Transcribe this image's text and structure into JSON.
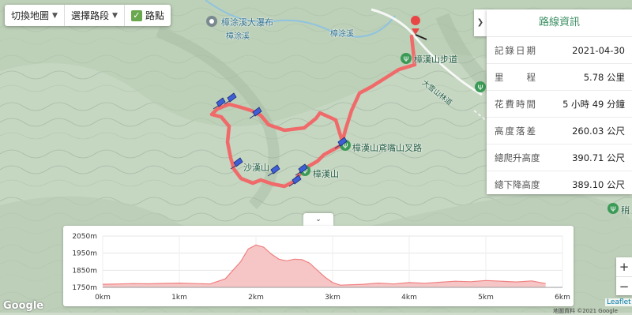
{
  "toolbar": {
    "switch_map": "切換地圖",
    "select_segment": "選擇路段",
    "waypoint": "路點"
  },
  "map_labels": {
    "waterfall": "樟涂溪大瀑布",
    "creek_1": "樟涂溪",
    "creek_2": "樟涂溪",
    "trail": "樟漢山步道",
    "road": "大雪山林道",
    "junction": "樟漢山鳶嘴山叉路",
    "peak_1": "沙漢山",
    "peak_2": "樟漢山",
    "right_peak": "稍"
  },
  "stats": {
    "title": "路線資訊",
    "rows": [
      {
        "label": "記錄日期",
        "value": "2021-04-30"
      },
      {
        "label": "里　　程",
        "value": "5.78 公里"
      },
      {
        "label": "花費時間",
        "value": "5 小時 49 分鐘"
      },
      {
        "label": "高度落差",
        "value": "260.03 公尺"
      },
      {
        "label": "總爬升高度",
        "value": "390.71 公尺"
      },
      {
        "label": "總下降高度",
        "value": "389.10 公尺"
      }
    ]
  },
  "chart_data": {
    "type": "area",
    "x": [
      0,
      0.2,
      0.4,
      0.6,
      0.8,
      1.0,
      1.2,
      1.4,
      1.6,
      1.7,
      1.8,
      1.9,
      2.0,
      2.1,
      2.2,
      2.3,
      2.4,
      2.5,
      2.6,
      2.7,
      2.8,
      2.9,
      3.0,
      3.1,
      3.2,
      3.4,
      3.6,
      3.8,
      4.0,
      4.2,
      4.4,
      4.6,
      4.8,
      5.0,
      5.2,
      5.4,
      5.6,
      5.78
    ],
    "y": [
      1768,
      1770,
      1772,
      1771,
      1773,
      1775,
      1772,
      1770,
      1800,
      1850,
      1900,
      1975,
      1998,
      1985,
      1945,
      1915,
      1905,
      1915,
      1912,
      1892,
      1850,
      1810,
      1778,
      1763,
      1765,
      1768,
      1775,
      1770,
      1778,
      1774,
      1780,
      1786,
      1783,
      1790,
      1786,
      1782,
      1788,
      1772
    ],
    "xticks": [
      "0km",
      "1km",
      "2km",
      "3km",
      "4km",
      "5km",
      "6km"
    ],
    "yticks": [
      "2050m",
      "1950m",
      "1850m",
      "1750m"
    ],
    "xlim": [
      0,
      6
    ],
    "ylim": [
      1750,
      2050
    ],
    "fill_color": "#f6c6c6",
    "line_color": "#f08080"
  },
  "zoom": {
    "in": "+",
    "out": "−"
  },
  "attribution": {
    "google": "Google",
    "leaflet": "Leaflet",
    "footer": "地圖資料 ©2021 Google"
  },
  "colors": {
    "route": "#f06a6a",
    "accent": "#3b8f63"
  }
}
